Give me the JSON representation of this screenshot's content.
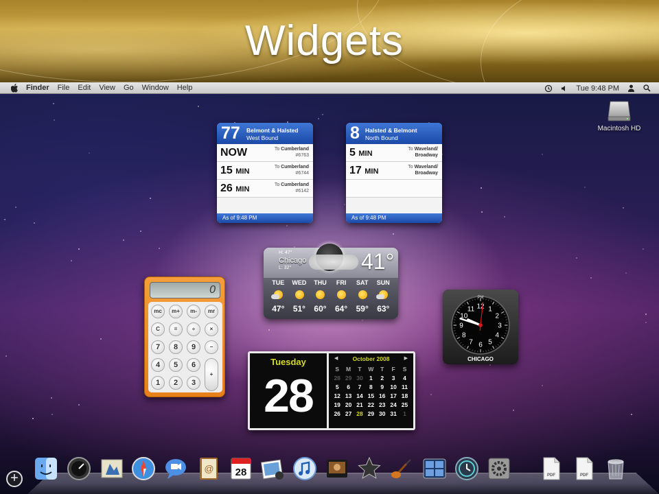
{
  "slide": {
    "title": "Widgets"
  },
  "menubar": {
    "items": [
      "Finder",
      "File",
      "Edit",
      "View",
      "Go",
      "Window",
      "Help"
    ],
    "clock": "Tue 9:48 PM"
  },
  "desktop": {
    "hd_label": "Macintosh HD"
  },
  "transit_widgets": [
    {
      "route": "77",
      "stop": "Belmont & Halsted",
      "direction": "West Bound",
      "arrivals": [
        {
          "time": "NOW",
          "unit": "",
          "to": "Cumberland",
          "bus": "#6763"
        },
        {
          "time": "15",
          "unit": "MIN",
          "to": "Cumberland",
          "bus": "#6744"
        },
        {
          "time": "26",
          "unit": "MIN",
          "to": "Cumberland",
          "bus": "#6142"
        }
      ],
      "footer": "As of 9:48 PM"
    },
    {
      "route": "8",
      "stop": "Halsted & Belmont",
      "direction": "North Bound",
      "arrivals": [
        {
          "time": "5",
          "unit": "MIN",
          "to": "Waveland/",
          "to2": "Broadway"
        },
        {
          "time": "17",
          "unit": "MIN",
          "to": "Waveland/",
          "to2": "Broadway"
        }
      ],
      "footer": "As of 9:48 PM"
    }
  ],
  "weather": {
    "hi": "H: 47°",
    "city": "Chicago",
    "lo": "L: 32°",
    "temp": "41°",
    "days": [
      {
        "day": "TUE",
        "temp": "47°",
        "icon": "partly-cloudy-icon"
      },
      {
        "day": "WED",
        "temp": "51°",
        "icon": "sun-icon"
      },
      {
        "day": "THU",
        "temp": "60°",
        "icon": "sun-icon"
      },
      {
        "day": "FRI",
        "temp": "64°",
        "icon": "sun-icon"
      },
      {
        "day": "SAT",
        "temp": "59°",
        "icon": "sun-icon"
      },
      {
        "day": "SUN",
        "temp": "63°",
        "icon": "partly-cloudy-icon"
      }
    ]
  },
  "calculator": {
    "display": "0",
    "keys": {
      "mc": "mc",
      "mplus": "m+",
      "mminus": "m-",
      "mr": "mr",
      "clear": "C",
      "equals": "=",
      "divide": "÷",
      "multiply": "×",
      "minus": "−",
      "plus": "+",
      "seven": "7",
      "eight": "8",
      "nine": "9",
      "four": "4",
      "five": "5",
      "six": "6",
      "one": "1",
      "two": "2",
      "three": "3",
      "zero": "0",
      "dot": "."
    }
  },
  "clock": {
    "city": "CHICAGO",
    "ampm": "PM",
    "hour": 9,
    "minute": 48,
    "second": 1,
    "numerals": [
      "12",
      "1",
      "2",
      "3",
      "4",
      "5",
      "6",
      "7",
      "8",
      "9",
      "10",
      "11"
    ]
  },
  "calendar": {
    "weekday": "Tuesday",
    "day": "28",
    "month_title": "October 2008",
    "headers": [
      "S",
      "M",
      "T",
      "W",
      "T",
      "F",
      "S"
    ],
    "weeks": [
      [
        "28",
        "29",
        "30",
        "1",
        "2",
        "3",
        "4"
      ],
      [
        "5",
        "6",
        "7",
        "8",
        "9",
        "10",
        "11"
      ],
      [
        "12",
        "13",
        "14",
        "15",
        "16",
        "17",
        "18"
      ],
      [
        "19",
        "20",
        "21",
        "22",
        "23",
        "24",
        "25"
      ],
      [
        "26",
        "27",
        "28",
        "29",
        "30",
        "31",
        "1"
      ]
    ],
    "dim_first_row_count": 3,
    "dim_last_row_count": 1,
    "today": "28"
  },
  "dock": {
    "items": [
      {
        "name": "finder-icon"
      },
      {
        "name": "dashboard-icon"
      },
      {
        "name": "mail-icon"
      },
      {
        "name": "safari-icon"
      },
      {
        "name": "ichat-icon"
      },
      {
        "name": "address-book-icon"
      },
      {
        "name": "ical-icon",
        "label": "28"
      },
      {
        "name": "iphoto-icon"
      },
      {
        "name": "itunes-icon"
      },
      {
        "name": "photo-booth-icon"
      },
      {
        "name": "imovie-icon"
      },
      {
        "name": "garageband-icon"
      },
      {
        "name": "spaces-icon"
      },
      {
        "name": "time-machine-icon"
      },
      {
        "name": "system-preferences-icon"
      },
      {
        "name": "pdf-document-icon",
        "label": "PDF"
      },
      {
        "name": "pdf-document-icon",
        "label": "PDF"
      },
      {
        "name": "trash-icon"
      }
    ]
  },
  "colors": {
    "transit_blue": "#1b4aa8",
    "calc_orange": "#e8801a",
    "calendar_accent": "#d6dc27"
  }
}
